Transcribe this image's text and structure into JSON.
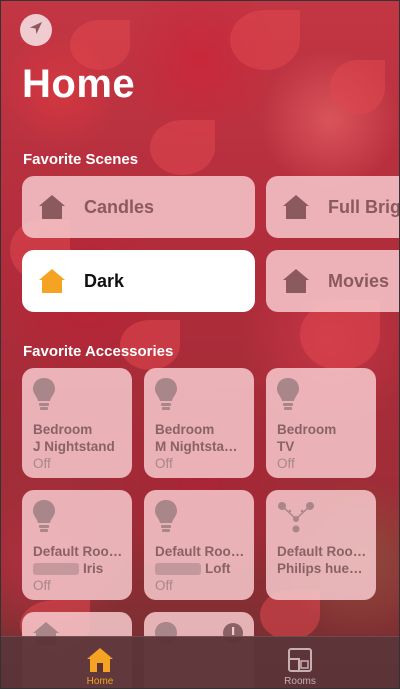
{
  "header": {
    "title": "Home",
    "location_icon": "location-arrow-icon"
  },
  "favorite_scenes": {
    "title": "Favorite Scenes",
    "items": [
      {
        "label": "Candles",
        "icon": "house-icon",
        "active": false
      },
      {
        "label": "Full Brig",
        "icon": "house-icon",
        "active": false
      },
      {
        "label": "Dark",
        "icon": "house-icon",
        "active": true
      },
      {
        "label": "Movies",
        "icon": "house-icon",
        "active": false
      }
    ]
  },
  "favorite_accessories": {
    "title": "Favorite Accessories",
    "items": [
      {
        "line1": "Bedroom",
        "line2": "J Nightstand",
        "status": "Off",
        "icon": "lightbulb-icon"
      },
      {
        "line1": "Bedroom",
        "line2": "M Nightsta…",
        "status": "Off",
        "icon": "lightbulb-icon"
      },
      {
        "line1": "Bedroom",
        "line2": "TV",
        "status": "Off",
        "icon": "lightbulb-icon"
      },
      {
        "line1": "Default Roo…",
        "line2": "Iris",
        "status": "Off",
        "icon": "lightbulb-icon"
      },
      {
        "line1": "Default Roo…",
        "line2": "Loft",
        "status": "Off",
        "icon": "lightbulb-icon"
      },
      {
        "line1": "Default Roo…",
        "line2": "Philips hue…",
        "status": "",
        "icon": "hue-bridge-icon"
      }
    ]
  },
  "tabbar": {
    "tabs": [
      {
        "label": "Home",
        "icon": "house-icon",
        "active": true
      },
      {
        "label": "Rooms",
        "icon": "rooms-icon",
        "active": false
      }
    ]
  },
  "colors": {
    "accent": "#f4a323",
    "tile_bg": "#f6c8cc",
    "tile_text": "#8a6266",
    "tabbar_bg": "#5c3438"
  }
}
